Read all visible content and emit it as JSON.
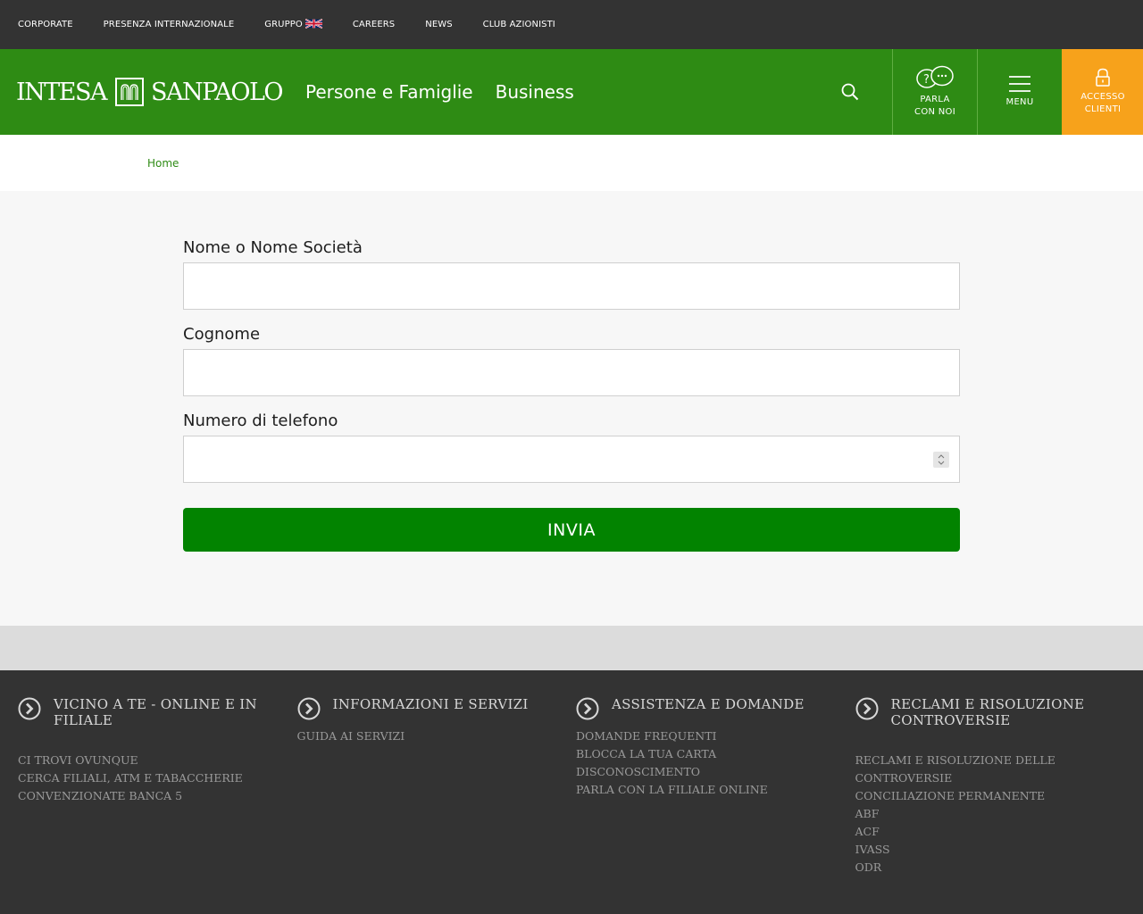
{
  "topbar": {
    "items": [
      "CORPORATE",
      "PRESENZA INTERNAZIONALE",
      "GRUPPO",
      "CAREERS",
      "NEWS",
      "CLUB AZIONISTI"
    ]
  },
  "header": {
    "logo_left": "INTESA",
    "logo_right": "SANPAOLO",
    "nav": [
      "Persone e Famiglie",
      "Business"
    ],
    "parla_line1": "PARLA",
    "parla_line2": "CON NOI",
    "menu": "MENU",
    "accesso_line1": "ACCESSO",
    "accesso_line2": "CLIENTI",
    "colors": {
      "brand_green": "#2e8b14",
      "accent_orange": "#f7a21b"
    }
  },
  "breadcrumb": {
    "home": "Home"
  },
  "form": {
    "name_label": "Nome o Nome Società",
    "name_value": "",
    "surname_label": "Cognome",
    "surname_value": "",
    "phone_label": "Numero di telefono",
    "phone_value": "",
    "submit_label": "INVIA",
    "submit_color": "#028300"
  },
  "footer": {
    "columns": [
      {
        "title": "VICINO A TE - ONLINE E IN FILIALE",
        "links": [
          "CI TROVI OVUNQUE",
          "CERCA FILIALI, ATM E TABACCHERIE CONVENZIONATE BANCA 5"
        ]
      },
      {
        "title": "INFORMAZIONI E SERVIZI",
        "links": [
          "GUIDA AI SERVIZI"
        ]
      },
      {
        "title": "ASSISTENZA E DOMANDE",
        "links": [
          "DOMANDE FREQUENTI",
          "BLOCCA LA TUA CARTA",
          "DISCONOSCIMENTO",
          "PARLA CON LA FILIALE ONLINE"
        ]
      },
      {
        "title": "RECLAMI E RISOLUZIONE CONTROVERSIE",
        "links": [
          "RECLAMI E RISOLUZIONE DELLE CONTROVERSIE",
          "CONCILIAZIONE PERMANENTE",
          "ABF",
          "ACF",
          "IVASS",
          "ODR"
        ]
      }
    ],
    "icon": "chevron-circle-right-icon"
  }
}
